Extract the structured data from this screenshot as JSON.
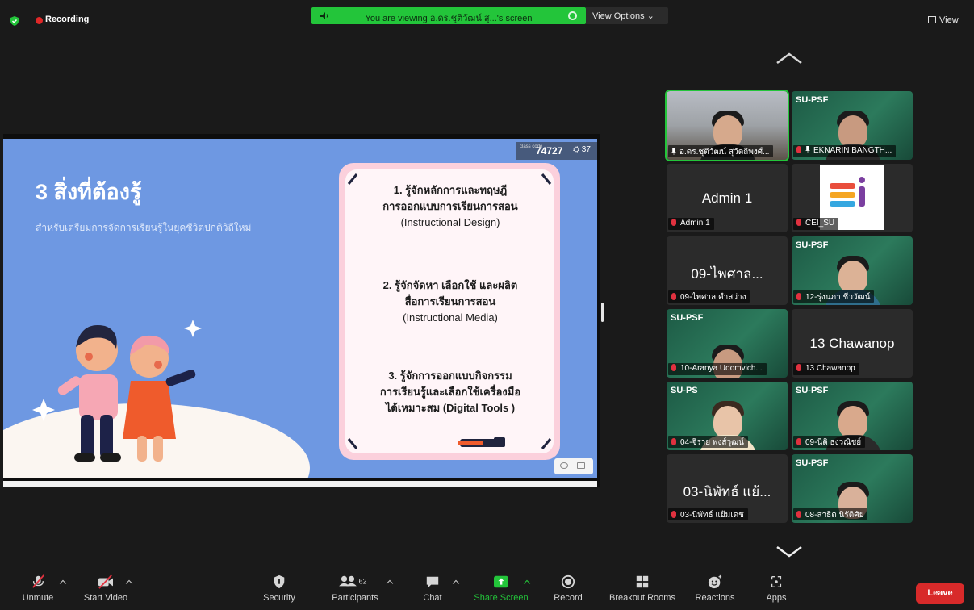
{
  "top_bar": {
    "recording_label": "Recording",
    "viewing_banner": "You are viewing อ.ดร.ชุติวัฒน์ สุ...'s screen",
    "view_options_label": "View Options",
    "view_label": "View"
  },
  "slide": {
    "title": "3 สิ่งที่ต้องรู้",
    "subtitle": "สำหรับเตรียมการจัดการเรียนรู้ในยุคชีวิตปกติวิถีใหม่",
    "class_code_label": "class code",
    "class_code": "74727",
    "participant_count": "37",
    "items": [
      {
        "lines": [
          "1. รู้จักหลักการและทฤษฎี",
          "การออกแบบการเรียนการสอน",
          "(Instructional Design)"
        ]
      },
      {
        "lines": [
          "2. รู้จักจัดหา เลือกใช้ และผลิต",
          "สื่อการเรียนการสอน",
          "(Instructional Media)"
        ]
      },
      {
        "lines": [
          "3. รู้จักการออกแบบกิจกรรม",
          "การเรียนรู้และเลือกใช้เครื่องมือ",
          "ได้เหมาะสม (Digital Tools )"
        ]
      }
    ]
  },
  "gallery": {
    "tiles": [
      {
        "name": "อ.ดร.ชุติวัฒน์ สุวัตถิพงศ์...",
        "display": "",
        "brand": "",
        "muted": false,
        "pinned": true
      },
      {
        "name": "EKNARIN BANGTH...",
        "display": "",
        "brand": "SU-PSF",
        "muted": true,
        "pinned": true
      },
      {
        "name": "Admin 1",
        "display": "Admin 1",
        "brand": "",
        "muted": true,
        "pinned": false
      },
      {
        "name": "CEI_SU",
        "display": "",
        "brand": "",
        "muted": true,
        "pinned": false
      },
      {
        "name": "09-ไพศาล คำสว่าง",
        "display": "09-ไพศาล...",
        "brand": "",
        "muted": true,
        "pinned": false
      },
      {
        "name": "12-รุ่งนภา ชีววัฒน์",
        "display": "",
        "brand": "SU-PSF",
        "muted": true,
        "pinned": false
      },
      {
        "name": "10-Aranya Udomvich...",
        "display": "",
        "brand": "SU-PSF",
        "muted": true,
        "pinned": false
      },
      {
        "name": "13 Chawanop",
        "display": "13 Chawanop",
        "brand": "",
        "muted": true,
        "pinned": false
      },
      {
        "name": "04-จิราย พงส์วุฒน์",
        "display": "",
        "brand": "SU-PS",
        "muted": true,
        "pinned": false
      },
      {
        "name": "09-นิติ ธงวณิชย์",
        "display": "",
        "brand": "SU-PSF",
        "muted": true,
        "pinned": false
      },
      {
        "name": "03-นิพัทธ์ แย้มเดช",
        "display": "03-นิพัทธ์ แย้...",
        "brand": "",
        "muted": true,
        "pinned": false
      },
      {
        "name": "08-สาธิต นิรัติศัย",
        "display": "",
        "brand": "SU-PSF",
        "muted": true,
        "pinned": false
      }
    ]
  },
  "toolbar": {
    "unmute": "Unmute",
    "start_video": "Start Video",
    "security": "Security",
    "participants": "Participants",
    "participants_count": "62",
    "chat": "Chat",
    "share_screen": "Share Screen",
    "record": "Record",
    "breakout_rooms": "Breakout Rooms",
    "reactions": "Reactions",
    "apps": "Apps",
    "leave": "Leave"
  },
  "colors": {
    "accent_green": "#23c53a",
    "leave_red": "#d82a2a",
    "slide_blue": "#6e98e2",
    "card_pink": "#fbd0dc"
  }
}
